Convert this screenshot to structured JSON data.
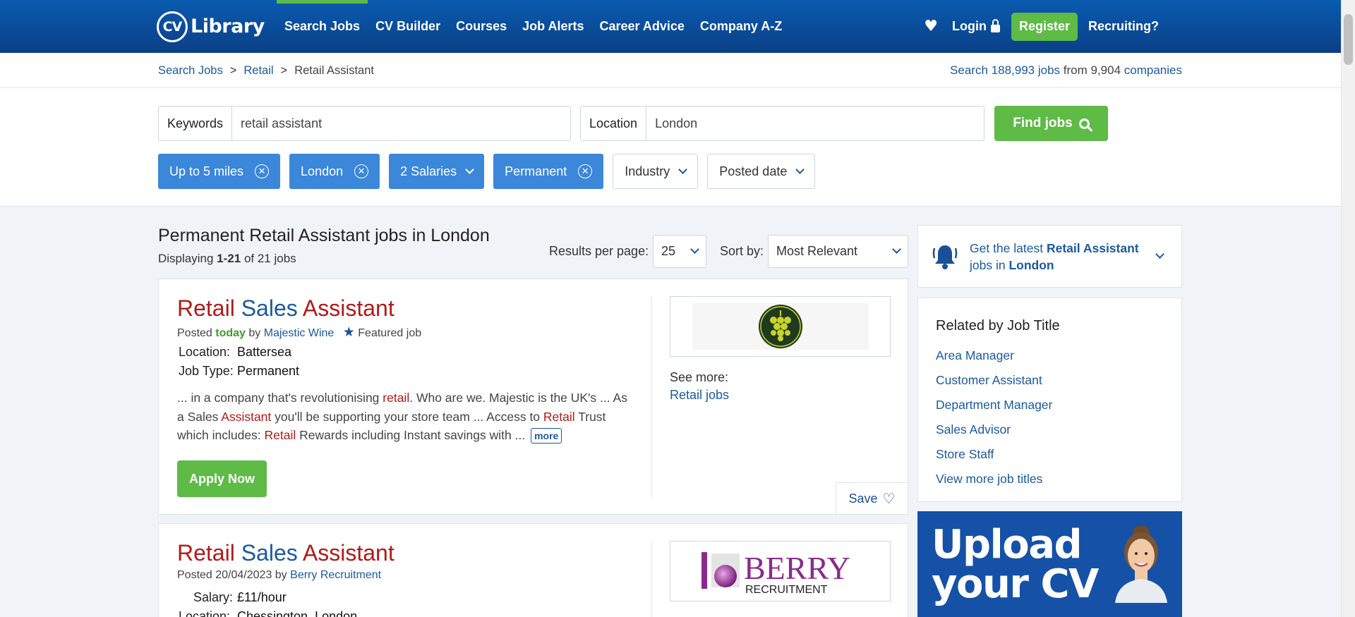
{
  "header": {
    "logo_text": "Library",
    "logo_badge": "CV",
    "nav": [
      "Search Jobs",
      "CV Builder",
      "Courses",
      "Job Alerts",
      "Career Advice",
      "Company A-Z"
    ],
    "login": "Login",
    "register": "Register",
    "recruiting": "Recruiting?"
  },
  "breadcrumb": {
    "items": [
      "Search Jobs",
      "Retail"
    ],
    "current": "Retail Assistant",
    "separator": ">"
  },
  "stats": {
    "prefix": "Search",
    "jobs": "188,993 jobs",
    "middle": "from 9,904",
    "companies": "companies"
  },
  "search": {
    "keywords_label": "Keywords",
    "keywords_value": "retail assistant",
    "location_label": "Location",
    "location_value": "London",
    "find_button": "Find jobs"
  },
  "filters": {
    "distance": "Up to 5 miles",
    "location": "London",
    "salaries": "2 Salaries",
    "type": "Permanent",
    "industry": "Industry",
    "posted_date": "Posted date"
  },
  "results": {
    "title": "Permanent Retail Assistant jobs in London",
    "count_prefix": "Displaying",
    "count_range": "1-21",
    "count_suffix": "of 21 jobs",
    "per_page_label": "Results per page:",
    "per_page_value": "25",
    "sort_label": "Sort by:",
    "sort_value": "Most Relevant"
  },
  "jobs": [
    {
      "title_words": [
        "Retail",
        "Sales",
        "Assistant"
      ],
      "posted_prefix": "Posted",
      "posted_when": "today",
      "posted_by": "by",
      "company": "Majestic Wine",
      "featured": "Featured job",
      "location_key": "Location:",
      "location_val": "Battersea",
      "jobtype_key": "Job Type:",
      "jobtype_val": "Permanent",
      "snippet_1": "... in a company that's revolutionising ",
      "snippet_hl1": "retail",
      "snippet_2": ". Who are we. Majestic is the UK's ... As a Sales ",
      "snippet_hl2": "Assistant",
      "snippet_3": " you'll be supporting your store team ... Access to ",
      "snippet_hl3": "Retail",
      "snippet_4": " Trust which includes: ",
      "snippet_hl4": "Retail",
      "snippet_5": " Rewards including Instant savings with ...",
      "more": "more",
      "apply": "Apply Now",
      "see_more_label": "See more:",
      "see_more_link": "Retail jobs",
      "save": "Save"
    },
    {
      "title_words": [
        "Retail",
        "Sales",
        "Assistant"
      ],
      "posted_prefix": "Posted 20/04/2023 by",
      "company": "Berry Recruitment",
      "logo_text": "BERRY",
      "logo_sub": "RECRUITMENT",
      "salary_key": "Salary:",
      "salary_val": "£11/hour",
      "location_key": "Location:",
      "location_val": "Chessington, London"
    }
  ],
  "sidebar": {
    "alert_prefix": "Get the latest",
    "alert_bold1": "Retail Assistant",
    "alert_mid": "jobs in",
    "alert_bold2": "London",
    "related_title": "Related by Job Title",
    "related": [
      "Area Manager",
      "Customer Assistant",
      "Department Manager",
      "Sales Advisor",
      "Store Staff",
      "View more job titles"
    ],
    "banner_line1": "Upload",
    "banner_line2": "your CV"
  },
  "colors": {
    "header_blue": "#0b4a9c",
    "accent_green": "#5dbb46",
    "chip_blue": "#3b87d9",
    "link_blue": "#1a5a9c",
    "highlight_red": "#b01a1a"
  }
}
